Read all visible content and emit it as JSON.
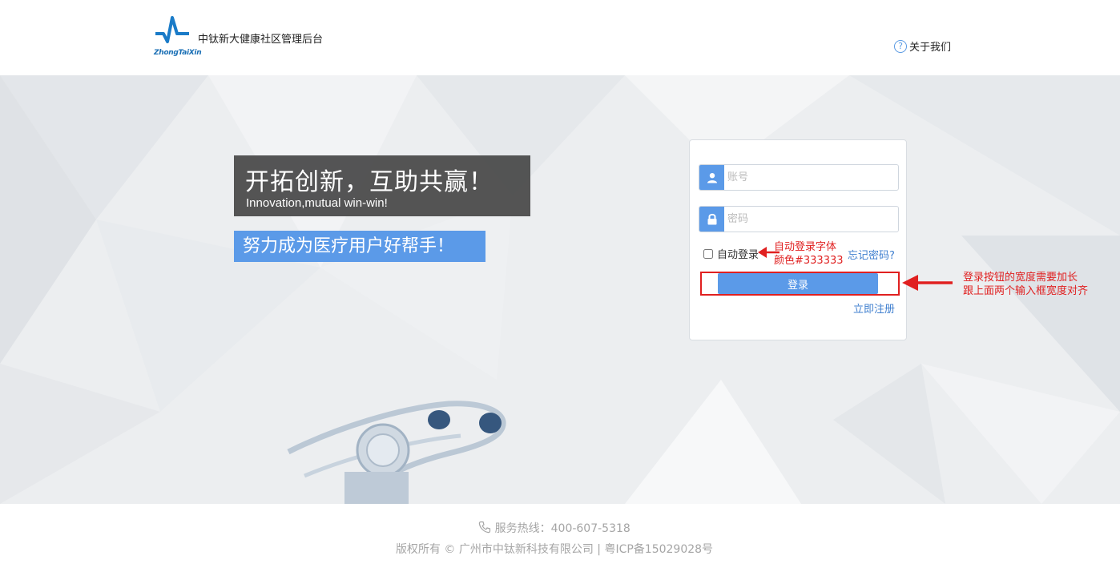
{
  "header": {
    "logo_text": "ZhongTaiXin",
    "site_title": "中钛新大健康社区管理后台",
    "about_label": "关于我们"
  },
  "banner": {
    "slogan_cn": "开拓创新，互助共赢！",
    "slogan_en": "Innovation,mutual win-win!",
    "sub_slogan": "努力成为医疗用户好帮手！"
  },
  "login": {
    "username_placeholder": "账号",
    "password_placeholder": "密码",
    "remember_label": "自动登录",
    "forgot_label": "忘记密码?",
    "login_button": "登录",
    "register_label": "立即注册"
  },
  "annotations": {
    "remember_note_line1": "自动登录字体",
    "remember_note_line2": "颜色#333333",
    "button_note_line1": "登录按钮的宽度需要加长",
    "button_note_line2": "跟上面两个输入框宽度对齐"
  },
  "footer": {
    "hotline": "服务热线：400-607-5318",
    "copyright": "版权所有 © 广州市中钛新科技有限公司 | 粤ICP备15029028号"
  },
  "colors": {
    "accent": "#5b9ae8",
    "annotation": "#e02020",
    "link": "#3f7fcf",
    "footer_text": "#a5a5a5"
  }
}
